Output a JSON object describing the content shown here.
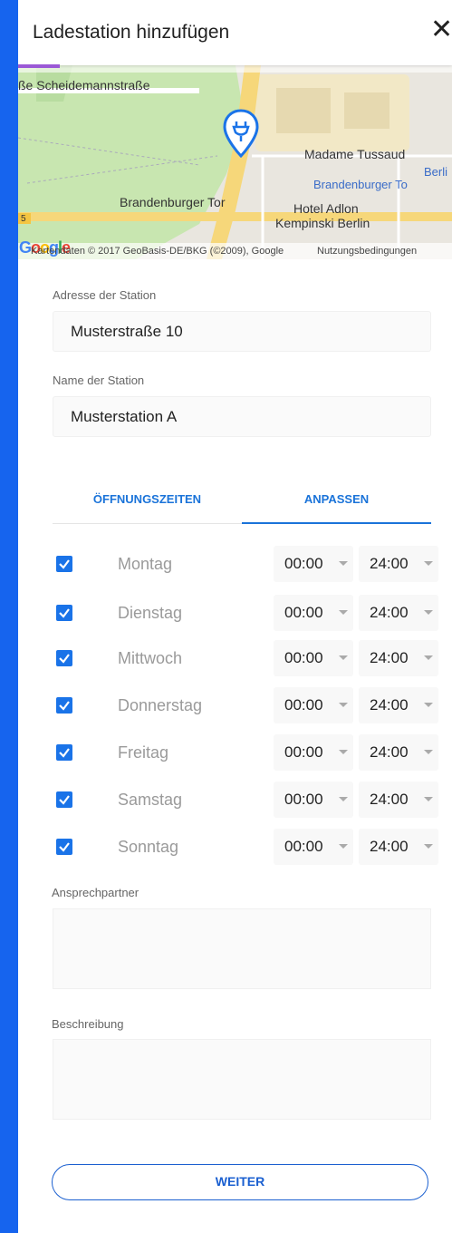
{
  "header": {
    "title": "Ladestation hinzufügen",
    "close_glyph": "✕"
  },
  "map": {
    "labels": {
      "street": "ße Scheidemannstraße",
      "madame": "Madame Tussaud",
      "berlin": "Berli",
      "bt_blue": "Brandenburger To",
      "brandenburger_tor": "Brandenburger Tor",
      "hotel1": "Hotel Adlon",
      "hotel2": "Kempinski Berlin",
      "road_num": "5"
    },
    "footer": {
      "logo": "Google",
      "attribution": "Kartendaten © 2017 GeoBasis-DE/BKG (©2009), Google",
      "terms": "Nutzungsbedingungen"
    }
  },
  "form": {
    "address_label": "Adresse der Station",
    "address_value": "Musterstraße 10",
    "name_label": "Name der Station",
    "name_value": "Musterstation A"
  },
  "tabs": [
    {
      "label": "ÖFFNUNGSZEITEN",
      "active": false
    },
    {
      "label": "ANPASSEN",
      "active": true
    }
  ],
  "days": [
    {
      "name": "Montag",
      "from": "00:00",
      "to": "24:00",
      "checked": true
    },
    {
      "name": "Dienstag",
      "from": "00:00",
      "to": "24:00",
      "checked": true
    },
    {
      "name": "Mittwoch",
      "from": "00:00",
      "to": "24:00",
      "checked": true
    },
    {
      "name": "Donnerstag",
      "from": "00:00",
      "to": "24:00",
      "checked": true
    },
    {
      "name": "Freitag",
      "from": "00:00",
      "to": "24:00",
      "checked": true
    },
    {
      "name": "Samstag",
      "from": "00:00",
      "to": "24:00",
      "checked": true
    },
    {
      "name": "Sonntag",
      "from": "00:00",
      "to": "24:00",
      "checked": true
    }
  ],
  "contact": {
    "label": "Ansprechpartner",
    "value": ""
  },
  "description": {
    "label": "Beschreibung",
    "value": ""
  },
  "button": {
    "label": "WEITER"
  },
  "colors": {
    "background": "#1664ee",
    "accent": "#1a73e8",
    "progress": "#9b59d6"
  }
}
